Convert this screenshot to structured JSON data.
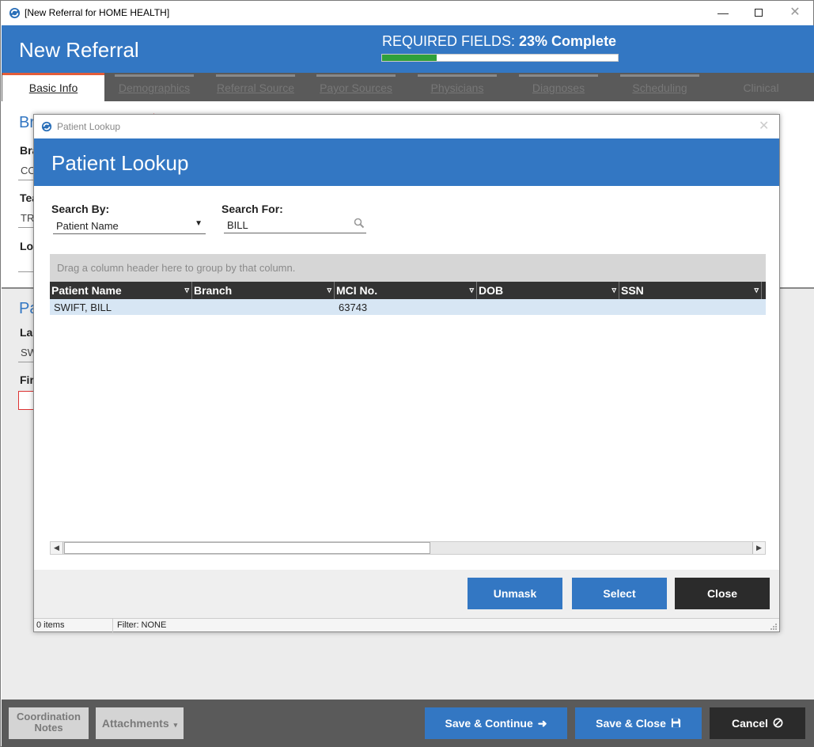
{
  "window": {
    "title": "[New Referral for HOME HEALTH]",
    "header_title": "New Referral",
    "progress": {
      "label_prefix": "REQUIRED FIELDS: ",
      "label_value": "23% Complete",
      "percent": 23
    }
  },
  "tabs": [
    {
      "label": "Basic Info",
      "active": true
    },
    {
      "label": "Demographics",
      "active": false
    },
    {
      "label": "Referral Source",
      "active": false
    },
    {
      "label": "Payor Sources",
      "active": false
    },
    {
      "label": "Physicians",
      "active": false
    },
    {
      "label": "Diagnoses",
      "active": false
    },
    {
      "label": "Scheduling",
      "active": false
    },
    {
      "label": "Clinical",
      "active": false
    }
  ],
  "background_form": {
    "section1": "Br",
    "label_branch": "Bra",
    "value_branch": "CO",
    "label_team": "Tea",
    "value_team": "TR",
    "label_location": "Loc",
    "section2": "Pa",
    "label_last": "Las",
    "value_last": "SW",
    "label_first": "Fir"
  },
  "bottom_bar": {
    "coordination_notes": "Coordination Notes",
    "attachments": "Attachments",
    "save_continue": "Save & Continue",
    "save_close": "Save & Close",
    "cancel": "Cancel"
  },
  "modal": {
    "window_title": "Patient Lookup",
    "header_title": "Patient Lookup",
    "search_by_label": "Search By:",
    "search_by_value": "Patient Name",
    "search_for_label": "Search For:",
    "search_for_value": "BILL",
    "group_hint": "Drag a column header here to group by that column.",
    "columns": [
      "Patient Name",
      "Branch",
      "MCI No.",
      "DOB",
      "SSN"
    ],
    "rows": [
      {
        "patient_name": "SWIFT, BILL",
        "branch": "",
        "mci_no": "63743",
        "dob": "",
        "ssn": ""
      }
    ],
    "buttons": {
      "unmask": "Unmask",
      "select": "Select",
      "close": "Close"
    },
    "status": {
      "items": "0 items",
      "filter": "Filter: NONE"
    }
  },
  "colors": {
    "brand_blue": "#3377c3",
    "progress_green": "#2fa03a",
    "active_tab_accent": "#e35d3a",
    "dark_button": "#2b2b2b"
  }
}
